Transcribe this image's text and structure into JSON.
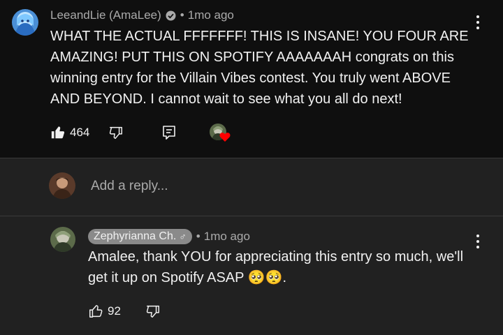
{
  "main_comment": {
    "author": "LeeandLie (AmaLee)",
    "time": "1mo ago",
    "text": "WHAT THE ACTUAL FFFFFFF! THIS IS INSANE! YOU FOUR ARE AMAZING! PUT THIS ON SPOTIFY AAAAAAAH congrats on this winning entry for the Villain Vibes contest. You truly went ABOVE AND BEYOND. I cannot wait to see what you all do next!",
    "like_count": "464",
    "icons": {
      "like": "thumbs-up-filled-icon",
      "dislike": "thumbs-down-icon",
      "reply": "reply-icon",
      "heart": "creator-heart-icon",
      "more": "more-vert-icon"
    }
  },
  "reply_box": {
    "placeholder": "Add a reply..."
  },
  "reply_comment": {
    "author": "Zephyrianna Ch.",
    "gender_symbol": "♂",
    "time": "1mo ago",
    "text": "Amalee, thank YOU for appreciating this entry so much, we'll get it up on Spotify ASAP 🥺🥺.",
    "like_count": "92",
    "icons": {
      "like": "thumbs-up-outline-icon",
      "dislike": "thumbs-down-icon",
      "more": "more-vert-icon"
    }
  },
  "colors": {
    "background_top": "#0f0f0f",
    "background_reply": "#212121",
    "text_primary": "#f1f1f1",
    "text_secondary": "#aaaaaa",
    "heart": "#ff0000",
    "author_pill": "#8a8a8a"
  }
}
